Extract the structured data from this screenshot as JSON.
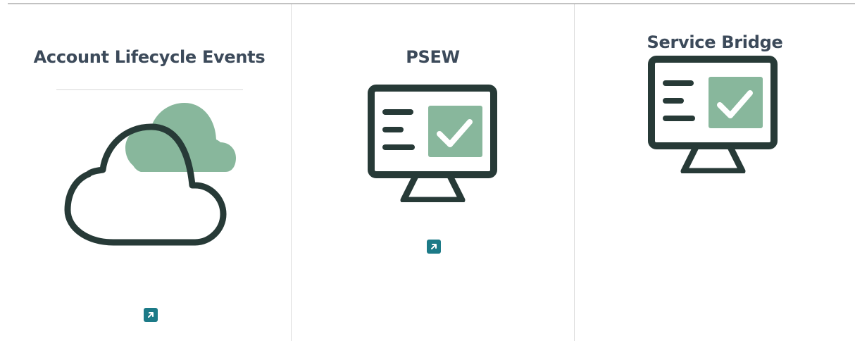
{
  "theme": {
    "title_color": "#3c4a5a",
    "icon_stroke": "#273a37",
    "icon_accent": "#88b79c",
    "link_button_bg": "#1c7a87",
    "link_icon_color": "#ffffff"
  },
  "cards": [
    {
      "title": "Account Lifecycle Events",
      "illustration_icon": "cloud-icon",
      "link_icon": "external-link-icon"
    },
    {
      "title": "PSEW",
      "illustration_icon": "monitor-checklist-icon",
      "link_icon": "external-link-icon"
    },
    {
      "title": "Service Bridge",
      "illustration_icon": "monitor-checklist-icon"
    }
  ]
}
